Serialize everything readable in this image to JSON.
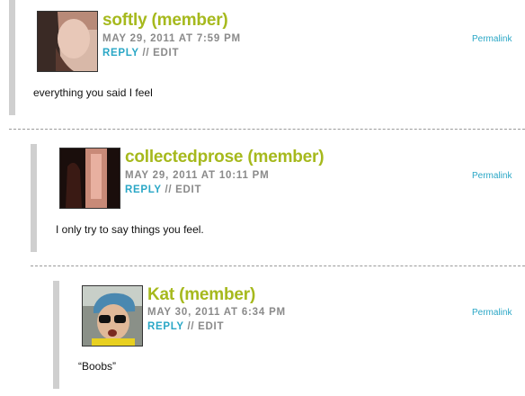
{
  "comments": [
    {
      "author": "softly (member)",
      "date": "MAY 29, 2011 AT 7:59 PM",
      "reply": "REPLY",
      "separator": "//",
      "edit": "EDIT",
      "permalink": "Permalink",
      "text": "everything you said I feel"
    },
    {
      "author": "collectedprose (member)",
      "date": "MAY 29, 2011 AT 10:11 PM",
      "reply": "REPLY",
      "separator": "//",
      "edit": "EDIT",
      "permalink": "Permalink",
      "text": "I only try to say things you feel."
    },
    {
      "author": "Kat (member)",
      "date": "MAY 30, 2011 AT 6:34 PM",
      "reply": "REPLY",
      "separator": "//",
      "edit": "EDIT",
      "permalink": "Permalink",
      "text": "“Boobs”"
    }
  ],
  "colors": {
    "author": "#a6b91d",
    "link": "#2aa7c6",
    "meta": "#8a8a8a",
    "thread_bar": "#cfcfcf"
  }
}
